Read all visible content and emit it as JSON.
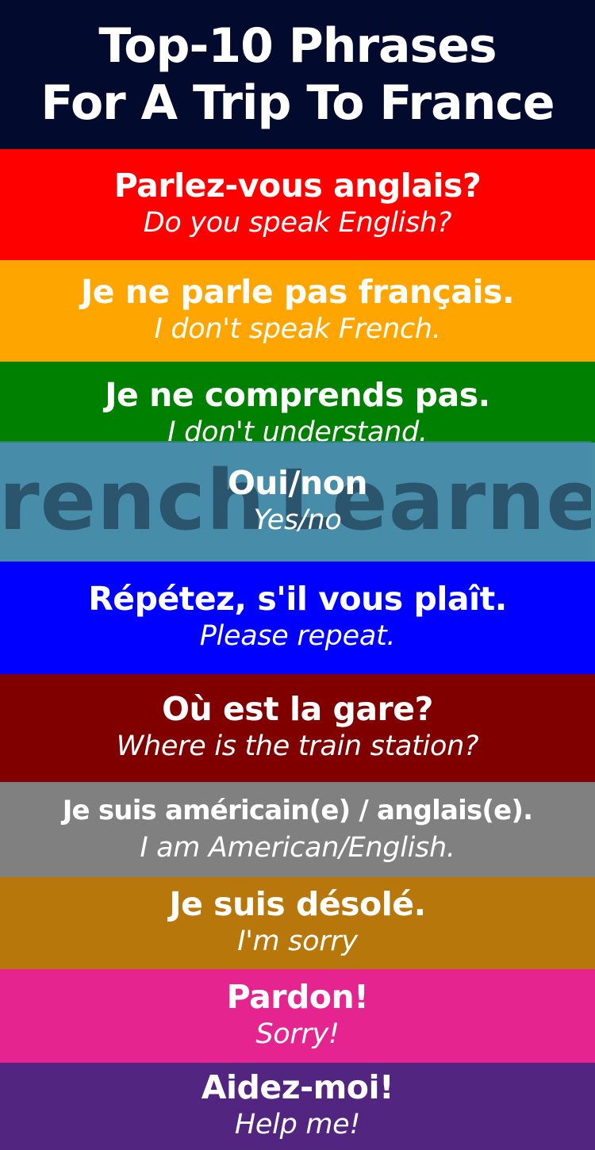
{
  "header": {
    "line1": "Top-10 Phrases",
    "line2": "For A Trip To France",
    "background": "#020a2e"
  },
  "watermark": {
    "left": "French",
    "right": "Learner"
  },
  "phrases": [
    {
      "fr": "Parlez-vous anglais?",
      "en": "Do you speak English?",
      "color": "#ff0000"
    },
    {
      "fr": "Je ne parle pas français.",
      "en": "I don't speak French.",
      "color": "#ffa500"
    },
    {
      "fr": "Je ne comprends pas.",
      "en": "I don't understand.",
      "color": "#008000"
    },
    {
      "fr": "Oui/non",
      "en": "Yes/no",
      "color": "#4a8fa8"
    },
    {
      "fr": "Répétez, s'il vous plaît.",
      "en": "Please repeat.",
      "color": "#0000ff"
    },
    {
      "fr": "Où est la gare?",
      "en": "Where is the train station?",
      "color": "#800000"
    },
    {
      "fr": "Je suis américain(e) / anglais(e).",
      "en": "I am American/English.",
      "color": "#808080"
    },
    {
      "fr": "Je suis désolé.",
      "en": "I'm sorry",
      "color": "#b8770a"
    },
    {
      "fr": "Pardon!",
      "en": "Sorry!",
      "color": "#e62490"
    },
    {
      "fr": "Aidez-moi!",
      "en": "Help me!",
      "color": "#512580"
    }
  ]
}
